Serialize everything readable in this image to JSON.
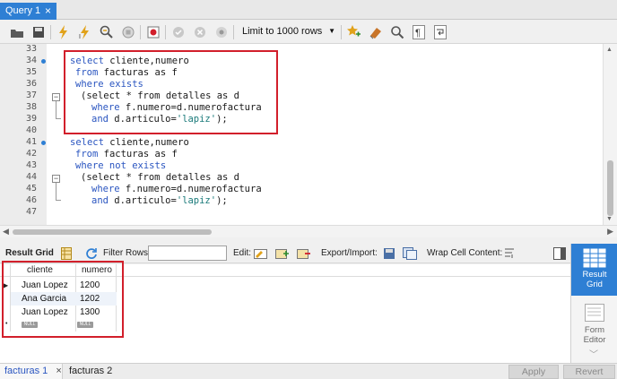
{
  "tabs": {
    "query_tab": "Query 1",
    "close": "×"
  },
  "toolbar": {
    "limit_value": "Limit to 1000 rows",
    "icons": [
      "open-folder-icon",
      "save-icon",
      "execute-icon",
      "execute-current-icon",
      "explain-icon",
      "stop-icon",
      "toggle-error-icon",
      "commit-icon",
      "rollback-icon",
      "autocommit-icon",
      "beautify-star-icon",
      "eraser-icon",
      "find-icon",
      "invisible-chars-icon",
      "wrap-icon"
    ]
  },
  "editor": {
    "line_numbers": [
      "33",
      "34",
      "35",
      "36",
      "37",
      "38",
      "39",
      "40",
      "41",
      "42",
      "43",
      "44",
      "45",
      "46",
      "47"
    ],
    "lines": [
      {
        "kw": "select",
        "rest": " cliente,numero"
      },
      {
        "kw": "from",
        "rest": " facturas as f"
      },
      {
        "kw": "where exists",
        "rest": ""
      },
      {
        "kw": "",
        "rest": "(select * from detalles as d"
      },
      {
        "kw": "where",
        "rest": " f.numero=d.numerofactura"
      },
      {
        "kw": "and",
        "rest": " d.articulo=",
        "str": "'lapiz'",
        "end": ");"
      }
    ],
    "lines2": [
      {
        "kw": "select",
        "rest": " cliente,numero"
      },
      {
        "kw": "from",
        "rest": " facturas as f"
      },
      {
        "kw": "where not exists",
        "rest": ""
      },
      {
        "kw": "",
        "rest": "(select * from detalles as d"
      },
      {
        "kw": "where",
        "rest": " f.numero=d.numerofactura"
      },
      {
        "kw": "and",
        "rest": " d.articulo=",
        "str": "'lapiz'",
        "end": ");"
      }
    ]
  },
  "results_toolbar": {
    "result_grid": "Result Grid",
    "filter_rows": "Filter Rows:",
    "edit": "Edit:",
    "export_import": "Export/Import:",
    "wrap_cell": "Wrap Cell Content:"
  },
  "grid": {
    "columns": [
      "cliente",
      "numero"
    ],
    "rows": [
      [
        "Juan Lopez",
        "1200"
      ],
      [
        "Ana Garcia",
        "1202"
      ],
      [
        "Juan Lopez",
        "1300"
      ]
    ],
    "null_label": "NULL"
  },
  "side_panel": {
    "result_grid_1": "Result",
    "result_grid_2": "Grid",
    "form_editor_1": "Form",
    "form_editor_2": "Editor"
  },
  "bottom": {
    "tab1": "facturas 1",
    "tab1_close": "×",
    "tab2": "facturas 2",
    "apply": "Apply",
    "revert": "Revert"
  },
  "colors": {
    "accent": "#2e7fd4",
    "highlight": "#d21f2b",
    "keyword": "#2a55c0",
    "string": "#1a7a7a"
  }
}
